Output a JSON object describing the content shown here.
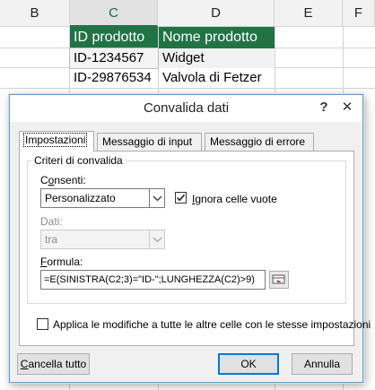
{
  "sheet": {
    "columns": [
      "B",
      "C",
      "D",
      "E",
      "F"
    ],
    "selected_column": "C",
    "table": {
      "headers": [
        "ID prodotto",
        "Nome prodotto"
      ],
      "rows": [
        [
          "ID-1234567",
          "Widget"
        ],
        [
          "ID-29876534",
          "Valvola di Fetzer"
        ]
      ]
    },
    "colors": {
      "header_fill": "#217346",
      "header_text": "#ffffff"
    }
  },
  "dialog": {
    "title": "Convalida dati",
    "help_label": "?",
    "close_label": "✕",
    "tabs": [
      {
        "label": "Impostazioni",
        "active": true
      },
      {
        "label": "Messaggio di input",
        "active": false
      },
      {
        "label": "Messaggio di errore",
        "active": false
      }
    ],
    "criteria_group": "Criteri di convalida",
    "allow": {
      "label_pre": "C",
      "label_key": "o",
      "label_post": "nsenti:",
      "value": "Personalizzato"
    },
    "ignore_blank": {
      "label_key": "I",
      "label_post": "gnora celle vuote",
      "checked": true
    },
    "data": {
      "label": "Dati:",
      "value": "tra",
      "enabled": false
    },
    "formula": {
      "label_key": "F",
      "label_post": "ormula:",
      "value": "=E(SINISTRA(C2;3)=\"ID-\";LUNGHEZZA(C2)>9)"
    },
    "apply_all": {
      "label": "Applica le modifiche a tutte le altre celle con le stesse impostazioni",
      "checked": false
    },
    "buttons": {
      "clear_key": "C",
      "clear_post": "ancella tutto",
      "ok": "OK",
      "cancel": "Annulla"
    },
    "accent_color": "#0078d7"
  }
}
